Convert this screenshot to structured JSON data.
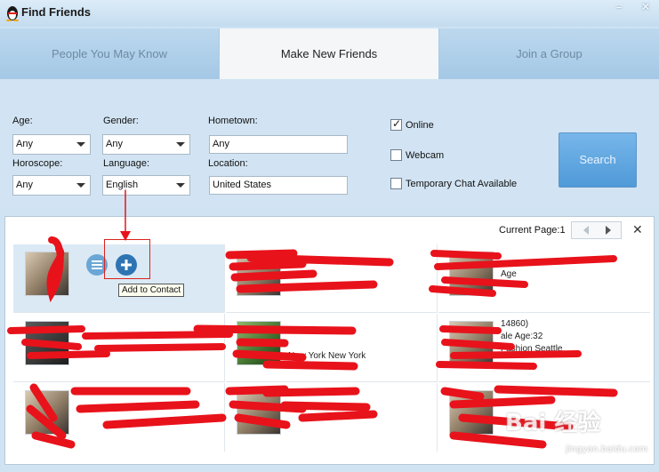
{
  "window": {
    "title": "Find Friends",
    "min_glyph": "–",
    "close_glyph": "✕"
  },
  "tabs": [
    {
      "label": "People You May Know",
      "active": false
    },
    {
      "label": "Make New Friends",
      "active": true
    },
    {
      "label": "Join a Group",
      "active": false
    }
  ],
  "filters": {
    "age": {
      "label": "Age:",
      "value": "Any"
    },
    "gender": {
      "label": "Gender:",
      "value": "Any"
    },
    "hometown": {
      "label": "Hometown:",
      "value": "Any"
    },
    "horoscope": {
      "label": "Horoscope:",
      "value": "Any"
    },
    "language": {
      "label": "Language:",
      "value": "English"
    },
    "location": {
      "label": "Location:",
      "value": "United States"
    },
    "online": {
      "label": "Online",
      "checked": true
    },
    "webcam": {
      "label": "Webcam",
      "checked": false
    },
    "temp_chat": {
      "label": "Temporary Chat Available",
      "checked": false
    }
  },
  "search_button": "Search",
  "results": {
    "current_page_label": "Current Page:1",
    "close_glyph": "✕",
    "tooltip": "Add to Contact",
    "cells": [
      {
        "lines": []
      },
      {
        "lines": [
          "Age"
        ]
      },
      {
        "lines": [
          "14860)",
          "ale  Age:32",
          "Fashion Seattle"
        ]
      },
      {
        "lines": [
          "New York New York"
        ]
      }
    ]
  },
  "watermark": {
    "main": "Bai 经验",
    "sub": "jingyan.baidu.com"
  },
  "colors": {
    "accent": "#4f9ad8",
    "scribble": "#e8121b",
    "highlight_cell": "#dbe9f5"
  }
}
